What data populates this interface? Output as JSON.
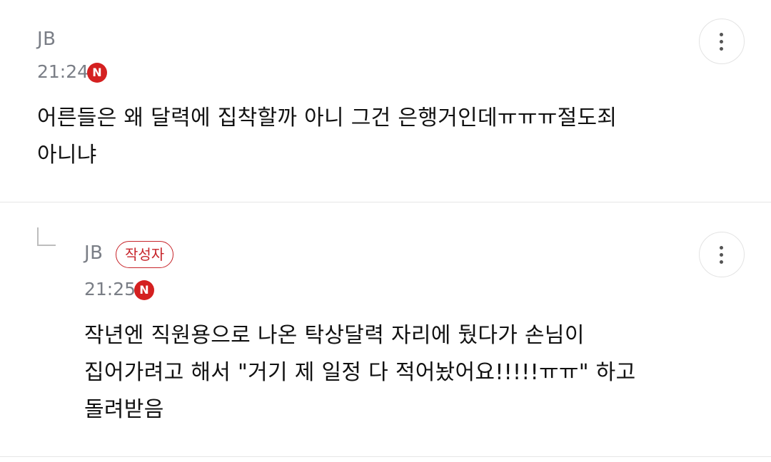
{
  "comments": [
    {
      "author": "JB",
      "time": "21:24",
      "badge": "N",
      "lines": [
        "어른들은 왜 달력에 집착할까 아니 그건 은행거인데ㅠㅠㅠ절도죄",
        "아니냐"
      ],
      "more_icon": "more-vertical-icon"
    },
    {
      "author": "JB",
      "writer_label": "작성자",
      "time": "21:25",
      "badge": "N",
      "lines": [
        "작년엔 직원용으로 나온 탁상달력 자리에 뒀다가 손님이",
        "집어가려고 해서 \"거기 제 일정 다 적어놨어요!!!!!ㅠㅠ\" 하고",
        "돌려받음"
      ],
      "more_icon": "more-vertical-icon",
      "reply_icon": "reply-arrow-icon"
    }
  ],
  "colors": {
    "badge_red": "#d42020",
    "writer_red": "#c7242a",
    "meta_gray": "#7a7e86"
  }
}
